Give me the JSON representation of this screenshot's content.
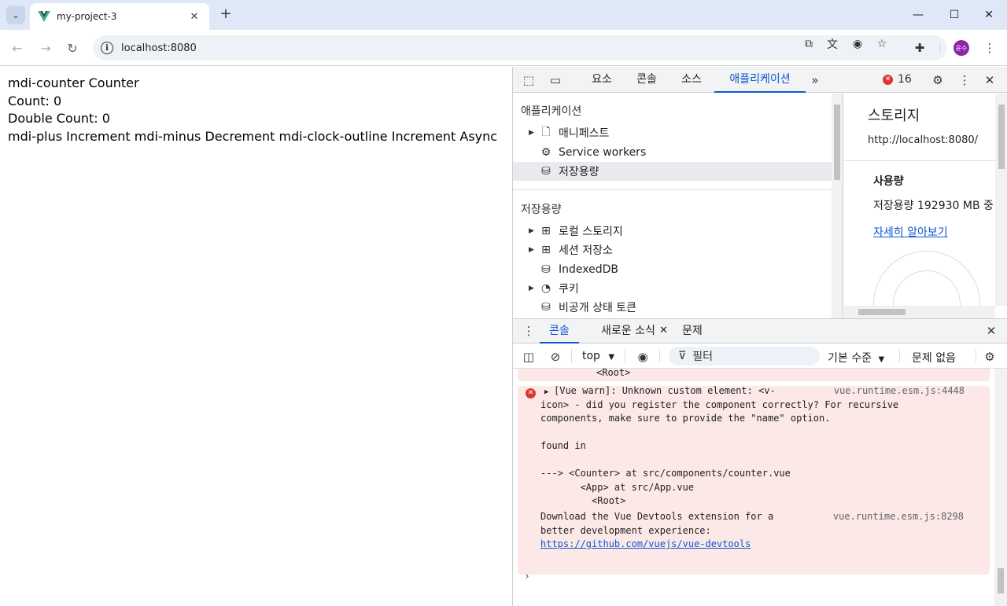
{
  "browser": {
    "tab_title": "my-project-3",
    "url": "localhost:8080",
    "avatar_text": "윤수",
    "accent_color": "#0b57d0"
  },
  "page": {
    "lines": [
      "mdi-counter Counter",
      "Count: 0",
      "Double Count: 0",
      "mdi-plus Increment mdi-minus Decrement mdi-clock-outline Increment Async"
    ]
  },
  "devtools": {
    "tabs": [
      "요소",
      "콘솔",
      "소스",
      "애플리케이션"
    ],
    "active_tab": "애플리케이션",
    "error_count": "16",
    "application_section": {
      "title": "애플리케이션",
      "items": [
        "매니페스트",
        "Service workers",
        "저장용량"
      ]
    },
    "storage_section": {
      "title": "저장용량",
      "items": [
        "로컬 스토리지",
        "세션 저장소",
        "IndexedDB",
        "쿠키",
        "비공개 상태 토큰"
      ]
    },
    "storage_panel": {
      "title": "스토리지",
      "origin": "http://localhost:8080/",
      "usage_heading": "사용량",
      "usage_text": "저장용량 192930 MB 중",
      "learn_more": "자세히 알아보기"
    },
    "drawer_tabs": [
      "콘솔",
      "새로운 소식",
      "문제"
    ],
    "console_toolbar": {
      "context": "top",
      "filter_placeholder": "필터",
      "levels": "기본 수준",
      "issues": "문제 없음"
    },
    "console": {
      "prev_tail": "<Root>",
      "warn_lines": [
        "[Vue warn]: Unknown custom element: <v-",
        "icon> - did you register the component correctly? For recursive",
        "components, make sure to provide the \"name\" option.",
        "",
        "found in",
        "",
        "---> <Counter> at src/components/counter.vue",
        "       <App> at src/App.vue",
        "         <Root>"
      ],
      "warn_source": "vue.runtime.esm.js:4448",
      "info_lines": [
        "Download the Vue Devtools extension for a",
        "better development experience:"
      ],
      "info_link": "https://github.com/vuejs/vue-devtools",
      "info_source": "vue.runtime.esm.js:8298"
    }
  }
}
